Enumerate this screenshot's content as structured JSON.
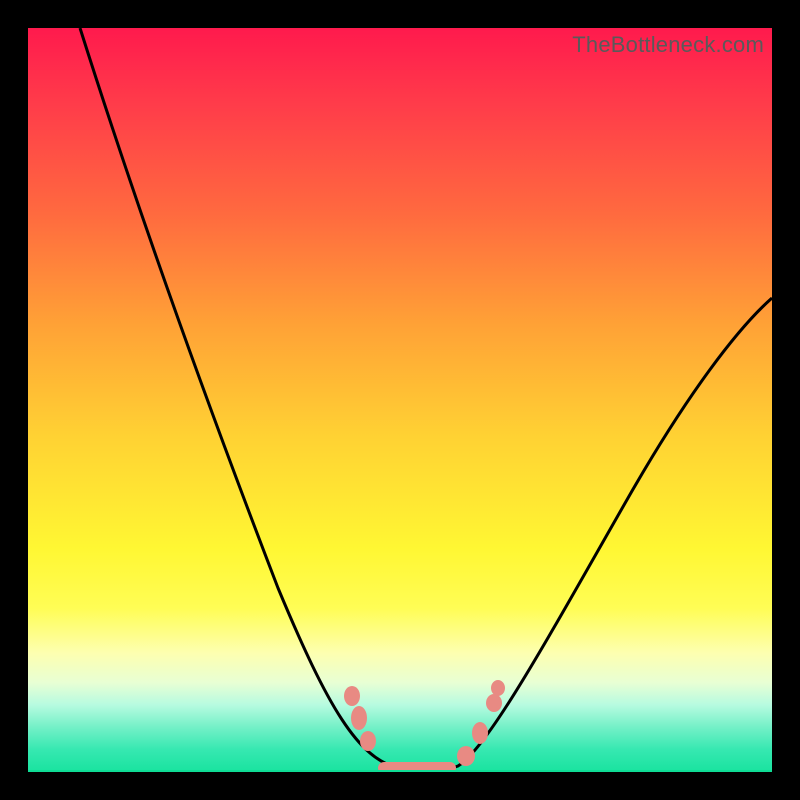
{
  "watermark": "TheBottleneck.com",
  "chart_data": {
    "type": "line",
    "title": "",
    "xlabel": "",
    "ylabel": "",
    "xlim": [
      0,
      100
    ],
    "ylim": [
      0,
      100
    ],
    "grid": false,
    "legend": false,
    "background_gradient_top": "#ff1a4d",
    "background_gradient_bottom": "#19e39f",
    "series": [
      {
        "name": "bottleneck-curve",
        "color": "#000000",
        "x": [
          7,
          10,
          15,
          20,
          25,
          30,
          35,
          40,
          44,
          47,
          50,
          53,
          55,
          57,
          60,
          65,
          70,
          75,
          80,
          85,
          90,
          95,
          100
        ],
        "y": [
          100,
          91,
          78,
          65,
          52,
          40,
          29,
          19,
          11,
          5,
          1,
          0,
          0,
          1,
          3,
          9,
          16,
          24,
          32,
          40,
          48,
          55,
          62
        ]
      },
      {
        "name": "flat-segment-markers",
        "color": "#e98880",
        "type": "scatter",
        "x": [
          44,
          46,
          48,
          50,
          52,
          54,
          56,
          58,
          60
        ],
        "y": [
          10,
          5,
          2,
          0,
          0,
          0,
          1,
          4,
          8
        ]
      }
    ],
    "annotations": []
  }
}
